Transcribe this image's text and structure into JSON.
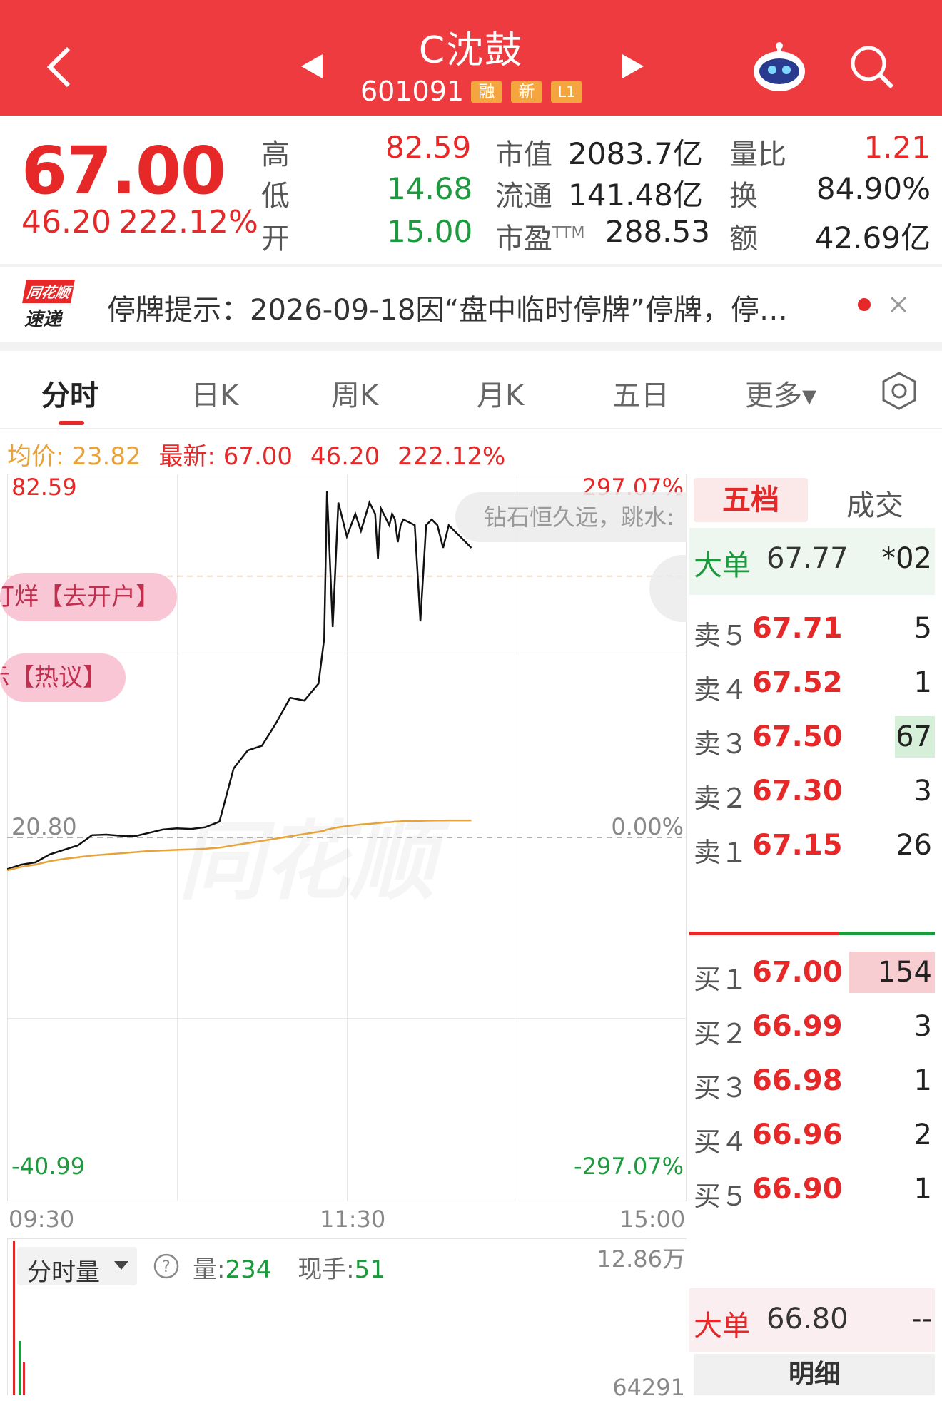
{
  "header": {
    "stock_name": "C沈鼓",
    "stock_code": "601091",
    "tags": [
      "融",
      "新",
      "L1"
    ]
  },
  "quote": {
    "price": "67.00",
    "change": "46.20",
    "change_pct": "222.12%",
    "high_label": "高",
    "high": "82.59",
    "low_label": "低",
    "low": "14.68",
    "open_label": "开",
    "open": "15.00",
    "mktcap_label": "市值",
    "mktcap": "2083.7亿",
    "float_label": "流通",
    "float_cap": "141.48亿",
    "pe_label": "市盈",
    "pe_sup": "TTM",
    "pe": "288.53",
    "vol_ratio_label": "量比",
    "vol_ratio": "1.21",
    "turnover_label": "换",
    "turnover": "84.90%",
    "amount_label": "额",
    "amount": "42.69亿"
  },
  "notice": {
    "logo_top": "同花顺",
    "logo_bottom": "速递",
    "text": "停牌提示：2026-09-18因“盘中临时停牌”停牌，停…"
  },
  "tabs": [
    "分时",
    "日K",
    "周K",
    "月K",
    "五日",
    "更多▾"
  ],
  "active_tab": 0,
  "chart_info": {
    "avg_label": "均价:",
    "avg": "23.82",
    "latest_label": "最新:",
    "latest": "67.00",
    "change": "46.20",
    "change_pct": "222.12%"
  },
  "chart_data": {
    "type": "line",
    "y_top": "82.59",
    "y_mid": "20.80",
    "y_bottom": "-40.99",
    "pct_top": "297.07%",
    "pct_mid": "0.00%",
    "pct_bottom": "-297.07%",
    "x_ticks": [
      "09:30",
      "11:30",
      "15:00"
    ],
    "ylim": [
      -40.99,
      82.59
    ],
    "prev_close": 20.8,
    "x": [
      0,
      5,
      10,
      15,
      20,
      25,
      30,
      35,
      40,
      45,
      50,
      55,
      60,
      65,
      70,
      75,
      80,
      85,
      90,
      95,
      100,
      105,
      110,
      112,
      113,
      115,
      117,
      120,
      123,
      125,
      128,
      130,
      131,
      132,
      133,
      134,
      135,
      136,
      137,
      138,
      139,
      140,
      142,
      144,
      146,
      148,
      150,
      152,
      154,
      156,
      158,
      160,
      162,
      164
    ],
    "series": [
      {
        "values": [
          15.2,
          16.0,
          16.4,
          17.8,
          18.6,
          19.4,
          21.2,
          21.3,
          21.1,
          21.0,
          21.6,
          22.2,
          22.4,
          22.3,
          22.6,
          23.6,
          33.0,
          36.2,
          37.0,
          41.0,
          45.5,
          45.0,
          48.0,
          56.0,
          82.0,
          58.0,
          80.0,
          74.0,
          78.0,
          75.0,
          80.0,
          78.0,
          70.0,
          79.0,
          78.0,
          77.0,
          76.0,
          78.0,
          77.0,
          73.0,
          76.0,
          77.0,
          76.5,
          76.0,
          59.0,
          76.0,
          77.0,
          76.0,
          72.0,
          76.0,
          75.0,
          74.0,
          73.0,
          72.0
        ]
      },
      {
        "values": [
          15.0,
          15.6,
          16.0,
          16.6,
          17.0,
          17.3,
          17.6,
          17.8,
          18.0,
          18.2,
          18.4,
          18.5,
          18.6,
          18.7,
          18.8,
          19.0,
          19.4,
          19.8,
          20.2,
          20.6,
          21.0,
          21.4,
          21.8,
          22.0,
          22.2,
          22.4,
          22.6,
          22.8,
          23.0,
          23.1,
          23.2,
          23.3,
          23.35,
          23.4,
          23.45,
          23.5,
          23.5,
          23.55,
          23.6,
          23.6,
          23.65,
          23.7,
          23.7,
          23.72,
          23.74,
          23.76,
          23.78,
          23.8,
          23.8,
          23.81,
          23.81,
          23.82,
          23.82,
          23.82
        ]
      }
    ]
  },
  "overlays": {
    "danmaku": "钻石恒久远，跳水:",
    "pill1": "订烊【去开户】",
    "pill2": "示【热议】",
    "watermark": "同花顺"
  },
  "orderbook": {
    "tab_active": "五档",
    "tab_other": "成交",
    "big_sell_label": "大单",
    "big_sell_price": "67.77",
    "big_sell_vol": "*02",
    "asks": [
      {
        "label": "卖５",
        "price": "67.71",
        "vol": "5"
      },
      {
        "label": "卖４",
        "price": "67.52",
        "vol": "1"
      },
      {
        "label": "卖３",
        "price": "67.50",
        "vol": "67"
      },
      {
        "label": "卖２",
        "price": "67.30",
        "vol": "3"
      },
      {
        "label": "卖１",
        "price": "67.15",
        "vol": "26"
      }
    ],
    "bids": [
      {
        "label": "买１",
        "price": "67.00",
        "vol": "154"
      },
      {
        "label": "买２",
        "price": "66.99",
        "vol": "3"
      },
      {
        "label": "买３",
        "price": "66.98",
        "vol": "1"
      },
      {
        "label": "买４",
        "price": "66.96",
        "vol": "2"
      },
      {
        "label": "买５",
        "price": "66.90",
        "vol": "1"
      }
    ],
    "big_buy_label": "大单",
    "big_buy_price": "66.80",
    "big_buy_vol": "--",
    "detail_label": "明细"
  },
  "volume": {
    "selector": "分时量",
    "vol_label": "量:",
    "vol": "234",
    "hand_label": "现手:",
    "hand": "51",
    "y_top": "12.86万",
    "y_mid": "64291"
  }
}
